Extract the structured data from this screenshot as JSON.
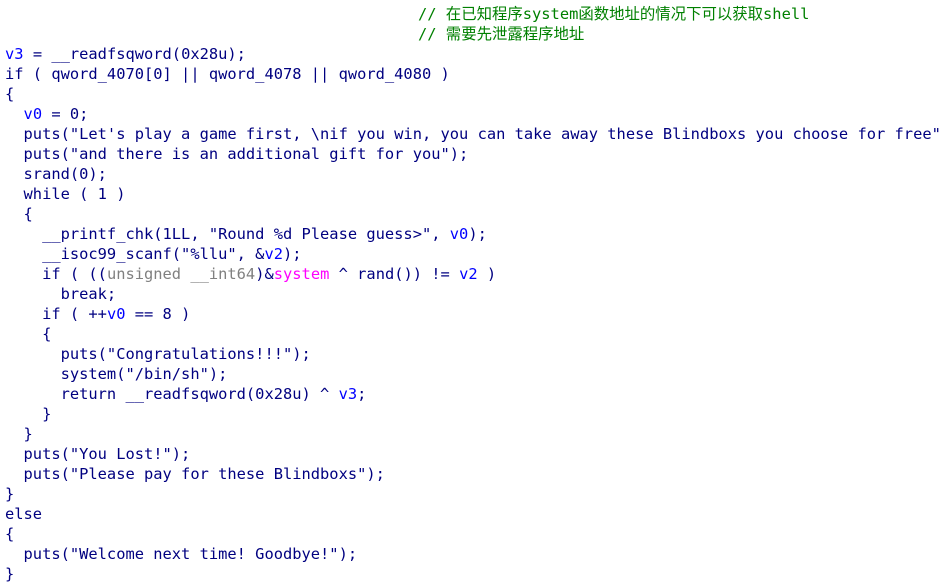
{
  "colors": {
    "background": "#ffffff",
    "code_text": "#000080",
    "variable": "#0000ff",
    "comment": "#008000",
    "keyword_gray": "#808080",
    "import_symbol": "#ff00ff"
  },
  "lines": [
    [
      {
        "t": "// 在已知程序system函数地址的情况下可以获取shell",
        "c": "cmt"
      }
    ],
    [
      {
        "t": "// 需要先泄露程序地址",
        "c": "cmt"
      }
    ],
    [
      {
        "t": "v3",
        "c": "var"
      },
      {
        "t": " = __readfsqword(0x28u);",
        "c": "normal"
      }
    ],
    [
      {
        "t": "if ( qword_4070[0] || qword_4078 || qword_4080 )",
        "c": "normal"
      }
    ],
    [
      {
        "t": "{",
        "c": "normal"
      }
    ],
    [
      {
        "t": "  ",
        "c": "normal"
      },
      {
        "t": "v0",
        "c": "var"
      },
      {
        "t": " = 0;",
        "c": "normal"
      }
    ],
    [
      {
        "t": "  puts(\"Let's play a game first, \\nif you win, you can take away these Blindboxs you choose for free\");",
        "c": "normal"
      }
    ],
    [
      {
        "t": "  puts(\"and there is an additional gift for you\");",
        "c": "normal"
      }
    ],
    [
      {
        "t": "  srand(0);",
        "c": "normal"
      }
    ],
    [
      {
        "t": "  while ( 1 )",
        "c": "normal"
      }
    ],
    [
      {
        "t": "  {",
        "c": "normal"
      }
    ],
    [
      {
        "t": "    __printf_chk(1LL, \"Round %d Please guess>\", ",
        "c": "normal"
      },
      {
        "t": "v0",
        "c": "var"
      },
      {
        "t": ");",
        "c": "normal"
      }
    ],
    [
      {
        "t": "    __isoc99_scanf(\"%llu\", &",
        "c": "normal"
      },
      {
        "t": "v2",
        "c": "var"
      },
      {
        "t": ");",
        "c": "normal"
      }
    ],
    [
      {
        "t": "    if ( ((",
        "c": "normal"
      },
      {
        "t": "unsigned __int64",
        "c": "gray"
      },
      {
        "t": ")&",
        "c": "normal"
      },
      {
        "t": "system",
        "c": "pink"
      },
      {
        "t": " ^ rand()) != ",
        "c": "normal"
      },
      {
        "t": "v2",
        "c": "var"
      },
      {
        "t": " )",
        "c": "normal"
      }
    ],
    [
      {
        "t": "      break;",
        "c": "normal"
      }
    ],
    [
      {
        "t": "    if ( ++",
        "c": "normal"
      },
      {
        "t": "v0",
        "c": "var"
      },
      {
        "t": " == 8 )",
        "c": "normal"
      }
    ],
    [
      {
        "t": "    {",
        "c": "normal"
      }
    ],
    [
      {
        "t": "      puts(\"Congratulations!!!\");",
        "c": "normal"
      }
    ],
    [
      {
        "t": "      system(\"/bin/sh\");",
        "c": "normal"
      }
    ],
    [
      {
        "t": "      return __readfsqword(0x28u) ^ ",
        "c": "normal"
      },
      {
        "t": "v3",
        "c": "var"
      },
      {
        "t": ";",
        "c": "normal"
      }
    ],
    [
      {
        "t": "    }",
        "c": "normal"
      }
    ],
    [
      {
        "t": "  }",
        "c": "normal"
      }
    ],
    [
      {
        "t": "  puts(\"You Lost!\");",
        "c": "normal"
      }
    ],
    [
      {
        "t": "  puts(\"Please pay for these Blindboxs\");",
        "c": "normal"
      }
    ],
    [
      {
        "t": "}",
        "c": "normal"
      }
    ],
    [
      {
        "t": "else",
        "c": "normal"
      }
    ],
    [
      {
        "t": "{",
        "c": "normal"
      }
    ],
    [
      {
        "t": "  puts(\"Welcome next time! Goodbye!\");",
        "c": "normal"
      }
    ],
    [
      {
        "t": "}",
        "c": "normal"
      }
    ]
  ]
}
